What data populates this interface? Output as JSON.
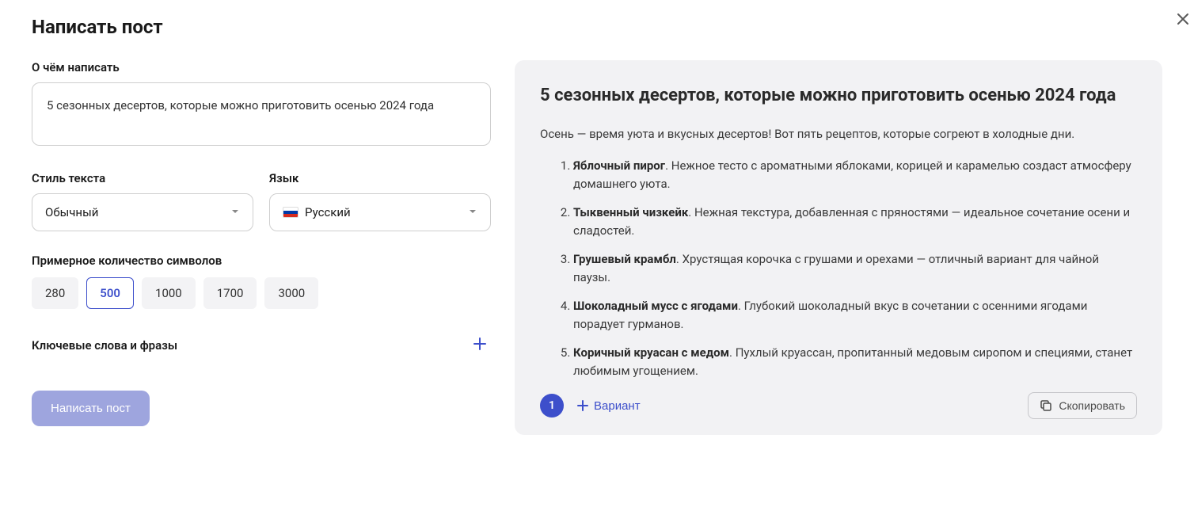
{
  "header": {
    "title": "Написать пост"
  },
  "form": {
    "topic_label": "О чём написать",
    "topic_value": "5 сезонных десертов, которые можно приготовить осенью 2024 года",
    "style_label": "Стиль текста",
    "style_value": "Обычный",
    "language_label": "Язык",
    "language_value": "Русский",
    "chars_label": "Примерное количество символов",
    "chars_options": [
      "280",
      "500",
      "1000",
      "1700",
      "3000"
    ],
    "chars_selected": "500",
    "keywords_label": "Ключевые слова и фразы",
    "submit_label": "Написать пост"
  },
  "result": {
    "title": "5 сезонных десертов, которые можно приготовить осенью 2024 года",
    "intro": "Осень — время уюта и вкусных десертов! Вот пять рецептов, которые согреют в холодные дни.",
    "items": [
      {
        "name": "Яблочный пирог",
        "desc": ". Нежное тесто с ароматными яблоками, корицей и карамелью создаст атмосферу домашнего уюта."
      },
      {
        "name": "Тыквенный чизкейк",
        "desc": ". Нежная текстура, добавленная с пряностями — идеальное сочетание осени и сладостей."
      },
      {
        "name": "Грушевый крамбл",
        "desc": ". Хрустящая корочка с грушами и орехами — отличный вариант для чайной паузы."
      },
      {
        "name": "Шоколадный мусс с ягодами",
        "desc": ". Глубокий шоколадный вкус в сочетании с осенними ягодами порадует гурманов."
      },
      {
        "name": "Коричный круасан с медом",
        "desc": ". Пухлый круассан, пропитанный медовым сиропом и специями, станет любимым угощением."
      }
    ],
    "variant_number": "1",
    "variant_label": "Вариант",
    "copy_label": "Скопировать"
  }
}
